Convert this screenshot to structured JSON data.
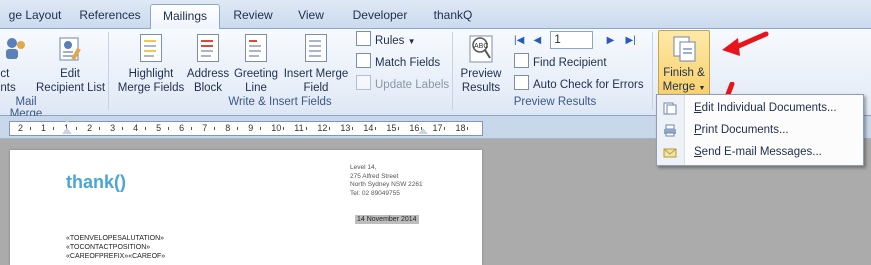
{
  "tabs": [
    "ge Layout",
    "References",
    "Mailings",
    "Review",
    "View",
    "Developer",
    "thankQ"
  ],
  "active_tab": "Mailings",
  "groups": {
    "start_mail_merge": {
      "label": "Mail Merge",
      "select_recipients": "ect\nents",
      "edit_recipient_list": "Edit\nRecipient List"
    },
    "write_insert": {
      "label": "Write & Insert Fields",
      "highlight": "Highlight\nMerge Fields",
      "address_block": "Address\nBlock",
      "greeting_line": "Greeting\nLine",
      "insert_merge_field": "Insert Merge\nField",
      "rules": "Rules",
      "match_fields": "Match Fields",
      "update_labels": "Update Labels"
    },
    "preview": {
      "label": "Preview Results",
      "preview_results": "Preview\nResults",
      "record_value": "1",
      "find_recipient": "Find Recipient",
      "auto_check": "Auto Check for Errors"
    },
    "finish": {
      "label_line1": "Finish &",
      "label_line2": "Merge"
    }
  },
  "finish_menu": {
    "items": [
      {
        "text": "Edit Individual Documents...",
        "accel": "E"
      },
      {
        "text": "Print Documents...",
        "accel": "P"
      },
      {
        "text": "Send E-mail Messages...",
        "accel": "S"
      }
    ]
  },
  "ruler": {
    "ticks": [
      "2",
      "1",
      "1",
      "2",
      "3",
      "4",
      "5",
      "6",
      "7",
      "8",
      "9",
      "10",
      "11",
      "12",
      "13",
      "14",
      "15",
      "16",
      "17",
      "18"
    ]
  },
  "document": {
    "logo_text": "thank",
    "address": [
      "Level 14,",
      "275 Alfred Street",
      "North Sydney NSW 2261",
      "Tel: 02 89049755"
    ],
    "date": "14 November 2014",
    "fields": [
      "«TOENVELOPESALUTATION»",
      "«TOCONTACTPOSITION»",
      "«CAREOFPREFIX»«CAREOF»"
    ]
  },
  "colors": {
    "ribbon_accent": "#3c5887",
    "finish_highlight": "#f9d86f",
    "arrow_red": "#e8141b",
    "logo_blue": "#4aa6d6"
  }
}
